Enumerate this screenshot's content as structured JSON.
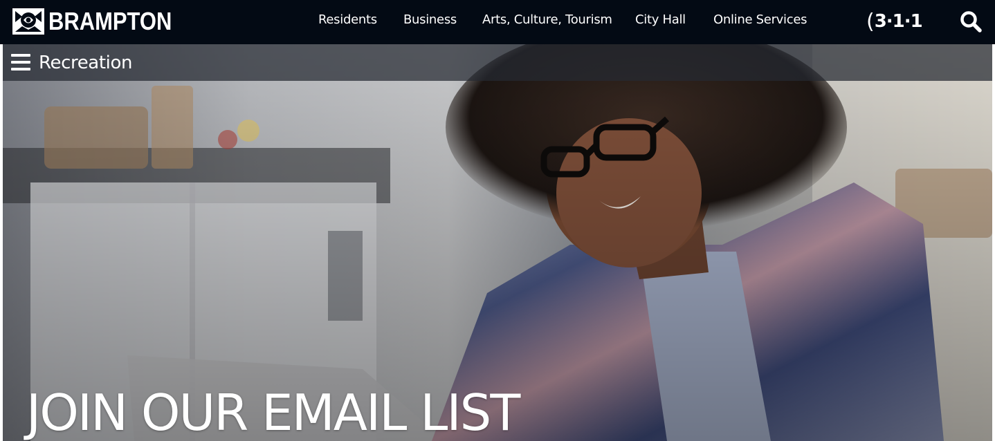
{
  "header": {
    "logo_text": "BRAMPTON",
    "logo_icon": "brampton-flower-logo",
    "nav": [
      {
        "label": "Residents"
      },
      {
        "label": "Business"
      },
      {
        "label": "Arts, Culture, Tourism"
      },
      {
        "label": "City Hall"
      },
      {
        "label": "Online Services"
      }
    ],
    "badge_311": "3·1·1",
    "search_icon": "search-icon"
  },
  "subnav": {
    "menu_icon": "hamburger-menu-icon",
    "title": "Recreation"
  },
  "hero": {
    "heading": "JOIN OUR EMAIL LIST",
    "image_description_icon": "hero-photo"
  },
  "colors": {
    "topbar_bg": "#030a14",
    "subnav_bg": "rgba(38,42,50,0.72)",
    "text": "#ffffff"
  }
}
